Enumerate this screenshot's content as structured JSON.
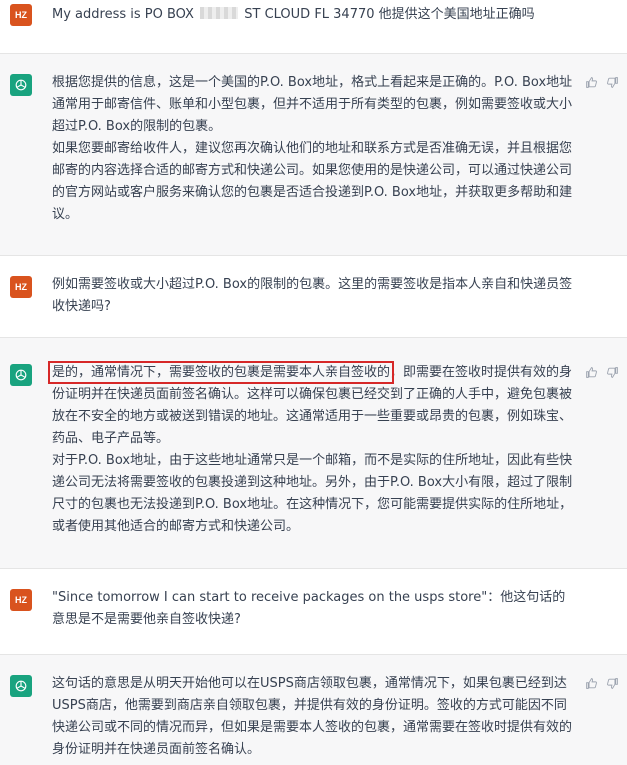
{
  "messages": [
    {
      "role": "user",
      "avatar": "HZ",
      "pre": "My address is PO BOX ",
      "post": " ST CLOUD FL 34770 他提供这个美国地址正确吗"
    },
    {
      "role": "assistant",
      "paragraphs": [
        "根据您提供的信息，这是一个美国的P.O. Box地址，格式上看起来是正确的。P.O. Box地址通常用于邮寄信件、账单和小型包裹，但并不适用于所有类型的包裹，例如需要签收或大小超过P.O. Box的限制的包裹。",
        "如果您要邮寄给收件人，建议您再次确认他们的地址和联系方式是否准确无误，并且根据您邮寄的内容选择合适的邮寄方式和快递公司。如果您使用的是快递公司，可以通过快递公司的官方网站或客户服务来确认您的包裹是否适合投递到P.O. Box地址，并获取更多帮助和建议。"
      ]
    },
    {
      "role": "user",
      "avatar": "HZ",
      "text": "例如需要签收或大小超过P.O. Box的限制的包裹。这里的需要签收是指本人亲自和快递员签收快递吗?"
    },
    {
      "role": "assistant",
      "highlight": "是的，通常情况下，需要签收的包裹是需要本人亲自签收的",
      "after_highlight": "，即需要在签收时提供有效的身份证明并在快递员面前签名确认。这样可以确保包裹已经交到了正确的人手中，避免包裹被放在不安全的地方或被送到错误的地址。这通常适用于一些重要或昂贵的包裹，例如珠宝、药品、电子产品等。",
      "paragraph2": "对于P.O. Box地址，由于这些地址通常只是一个邮箱，而不是实际的住所地址，因此有些快递公司无法将需要签收的包裹投递到这种地址。另外，由于P.O. Box大小有限，超过了限制尺寸的包裹也无法投递到P.O. Box地址。在这种情况下，您可能需要提供实际的住所地址，或者使用其他适合的邮寄方式和快递公司。"
    },
    {
      "role": "user",
      "avatar": "HZ",
      "text": "\"Since tomorrow I can start to receive packages on the usps store\"：他这句话的意思是不是需要他亲自签收快递?"
    },
    {
      "role": "assistant",
      "text": "这句话的意思是从明天开始他可以在USPS商店领取包裹，通常情况下，如果包裹已经到达USPS商店，他需要到商店亲自领取包裹，并提供有效的身份证明。签收的方式可能因不同快递公司或不同的情况而异，但如果是需要本人签收的包裹，通常需要在签收时提供有效的身份证明并在快递员面前签名确认。"
    }
  ],
  "colors": {
    "user_avatar": "#d9531e",
    "assistant_avatar": "#19a37f",
    "assistant_bg": "#f7f7f8",
    "highlight_border": "#d62828"
  },
  "icons": [
    "chatgpt-logo-icon",
    "thumbs-up-icon",
    "thumbs-down-icon"
  ]
}
